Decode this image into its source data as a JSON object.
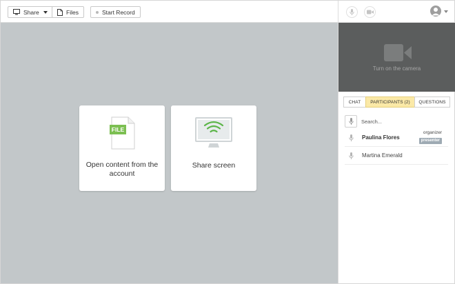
{
  "toolbar": {
    "share_label": "Share",
    "files_label": "Files",
    "record_label": "Start Record"
  },
  "stage": {
    "open_content_label": "Open content from the account",
    "file_badge_text": "FILE",
    "share_screen_label": "Share screen"
  },
  "panel": {
    "camera_label": "Turn on the camera",
    "tabs": [
      {
        "label": "CHAT",
        "active": false
      },
      {
        "label": "PARTICIPANTS (2)",
        "active": true
      },
      {
        "label": "QUESTIONS",
        "active": false
      }
    ],
    "search_placeholder": "Search...",
    "participants": [
      {
        "name": "Paulina Flores",
        "role": "organizer",
        "badge": "presenter"
      },
      {
        "name": "Martina Emerald",
        "role": "",
        "badge": ""
      }
    ]
  },
  "colors": {
    "stage_bg": "#c2c7c9",
    "camera_bg": "#5b5d5d",
    "file_green": "#7cbf52",
    "wifi_green": "#5bb548",
    "active_tab": "#fbe9a7",
    "presenter_badge": "#9eaab3"
  },
  "icons": [
    "monitor-icon",
    "chevron-down-icon",
    "file-icon",
    "record-dot-icon",
    "mic-icon",
    "video-camera-icon",
    "user-avatar-icon",
    "share-screen-icon"
  ]
}
